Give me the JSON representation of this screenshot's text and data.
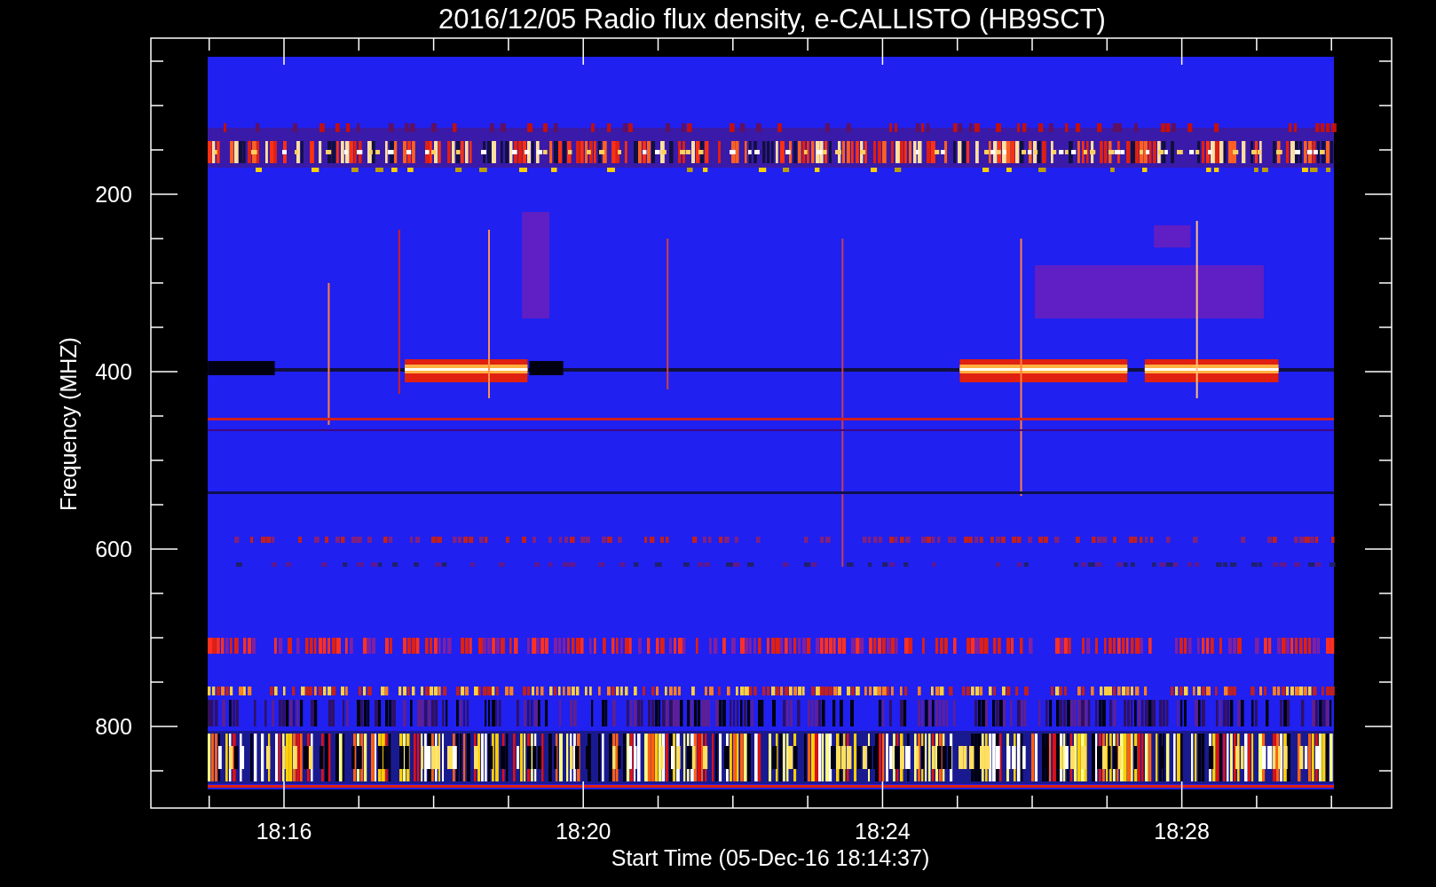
{
  "title": "2016/12/05  Radio flux density, e-CALLISTO (HB9SCT)",
  "y_axis": {
    "label": "Frequency (MHZ)",
    "ticks": [
      "200",
      "400",
      "600",
      "800"
    ]
  },
  "x_axis": {
    "label": "Start Time (05-Dec-16 18:14:37)",
    "ticks": [
      "18:16",
      "18:20",
      "18:24",
      "18:28"
    ]
  }
}
